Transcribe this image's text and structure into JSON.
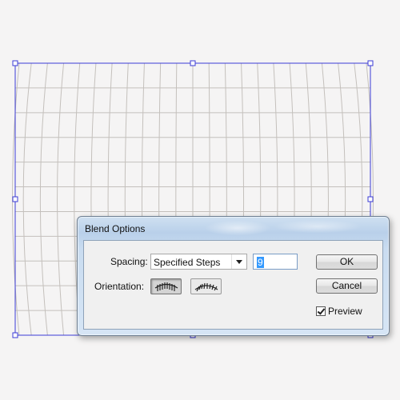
{
  "artwork": {
    "grid_color": "#c4c0bc",
    "selection_color": "#3b3bd6"
  },
  "dialog": {
    "title": "Blend Options",
    "spacing_label": "Spacing:",
    "spacing_value": "Specified Steps",
    "steps_value": "9",
    "orientation_label": "Orientation:",
    "orientation_options": [
      {
        "name": "align-to-page",
        "icon": "align-to-page-icon",
        "selected": true
      },
      {
        "name": "align-to-path",
        "icon": "align-to-path-icon",
        "selected": false
      }
    ],
    "ok_label": "OK",
    "cancel_label": "Cancel",
    "preview_label": "Preview",
    "preview_checked": true
  }
}
